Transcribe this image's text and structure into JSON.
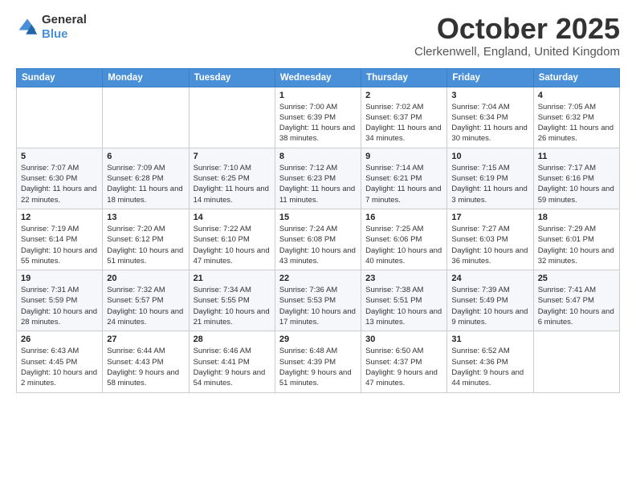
{
  "logo": {
    "general": "General",
    "blue": "Blue"
  },
  "header": {
    "month": "October 2025",
    "location": "Clerkenwell, England, United Kingdom"
  },
  "days_of_week": [
    "Sunday",
    "Monday",
    "Tuesday",
    "Wednesday",
    "Thursday",
    "Friday",
    "Saturday"
  ],
  "weeks": [
    [
      {
        "day": "",
        "info": ""
      },
      {
        "day": "",
        "info": ""
      },
      {
        "day": "",
        "info": ""
      },
      {
        "day": "1",
        "info": "Sunrise: 7:00 AM\nSunset: 6:39 PM\nDaylight: 11 hours and 38 minutes."
      },
      {
        "day": "2",
        "info": "Sunrise: 7:02 AM\nSunset: 6:37 PM\nDaylight: 11 hours and 34 minutes."
      },
      {
        "day": "3",
        "info": "Sunrise: 7:04 AM\nSunset: 6:34 PM\nDaylight: 11 hours and 30 minutes."
      },
      {
        "day": "4",
        "info": "Sunrise: 7:05 AM\nSunset: 6:32 PM\nDaylight: 11 hours and 26 minutes."
      }
    ],
    [
      {
        "day": "5",
        "info": "Sunrise: 7:07 AM\nSunset: 6:30 PM\nDaylight: 11 hours and 22 minutes."
      },
      {
        "day": "6",
        "info": "Sunrise: 7:09 AM\nSunset: 6:28 PM\nDaylight: 11 hours and 18 minutes."
      },
      {
        "day": "7",
        "info": "Sunrise: 7:10 AM\nSunset: 6:25 PM\nDaylight: 11 hours and 14 minutes."
      },
      {
        "day": "8",
        "info": "Sunrise: 7:12 AM\nSunset: 6:23 PM\nDaylight: 11 hours and 11 minutes."
      },
      {
        "day": "9",
        "info": "Sunrise: 7:14 AM\nSunset: 6:21 PM\nDaylight: 11 hours and 7 minutes."
      },
      {
        "day": "10",
        "info": "Sunrise: 7:15 AM\nSunset: 6:19 PM\nDaylight: 11 hours and 3 minutes."
      },
      {
        "day": "11",
        "info": "Sunrise: 7:17 AM\nSunset: 6:16 PM\nDaylight: 10 hours and 59 minutes."
      }
    ],
    [
      {
        "day": "12",
        "info": "Sunrise: 7:19 AM\nSunset: 6:14 PM\nDaylight: 10 hours and 55 minutes."
      },
      {
        "day": "13",
        "info": "Sunrise: 7:20 AM\nSunset: 6:12 PM\nDaylight: 10 hours and 51 minutes."
      },
      {
        "day": "14",
        "info": "Sunrise: 7:22 AM\nSunset: 6:10 PM\nDaylight: 10 hours and 47 minutes."
      },
      {
        "day": "15",
        "info": "Sunrise: 7:24 AM\nSunset: 6:08 PM\nDaylight: 10 hours and 43 minutes."
      },
      {
        "day": "16",
        "info": "Sunrise: 7:25 AM\nSunset: 6:06 PM\nDaylight: 10 hours and 40 minutes."
      },
      {
        "day": "17",
        "info": "Sunrise: 7:27 AM\nSunset: 6:03 PM\nDaylight: 10 hours and 36 minutes."
      },
      {
        "day": "18",
        "info": "Sunrise: 7:29 AM\nSunset: 6:01 PM\nDaylight: 10 hours and 32 minutes."
      }
    ],
    [
      {
        "day": "19",
        "info": "Sunrise: 7:31 AM\nSunset: 5:59 PM\nDaylight: 10 hours and 28 minutes."
      },
      {
        "day": "20",
        "info": "Sunrise: 7:32 AM\nSunset: 5:57 PM\nDaylight: 10 hours and 24 minutes."
      },
      {
        "day": "21",
        "info": "Sunrise: 7:34 AM\nSunset: 5:55 PM\nDaylight: 10 hours and 21 minutes."
      },
      {
        "day": "22",
        "info": "Sunrise: 7:36 AM\nSunset: 5:53 PM\nDaylight: 10 hours and 17 minutes."
      },
      {
        "day": "23",
        "info": "Sunrise: 7:38 AM\nSunset: 5:51 PM\nDaylight: 10 hours and 13 minutes."
      },
      {
        "day": "24",
        "info": "Sunrise: 7:39 AM\nSunset: 5:49 PM\nDaylight: 10 hours and 9 minutes."
      },
      {
        "day": "25",
        "info": "Sunrise: 7:41 AM\nSunset: 5:47 PM\nDaylight: 10 hours and 6 minutes."
      }
    ],
    [
      {
        "day": "26",
        "info": "Sunrise: 6:43 AM\nSunset: 4:45 PM\nDaylight: 10 hours and 2 minutes."
      },
      {
        "day": "27",
        "info": "Sunrise: 6:44 AM\nSunset: 4:43 PM\nDaylight: 9 hours and 58 minutes."
      },
      {
        "day": "28",
        "info": "Sunrise: 6:46 AM\nSunset: 4:41 PM\nDaylight: 9 hours and 54 minutes."
      },
      {
        "day": "29",
        "info": "Sunrise: 6:48 AM\nSunset: 4:39 PM\nDaylight: 9 hours and 51 minutes."
      },
      {
        "day": "30",
        "info": "Sunrise: 6:50 AM\nSunset: 4:37 PM\nDaylight: 9 hours and 47 minutes."
      },
      {
        "day": "31",
        "info": "Sunrise: 6:52 AM\nSunset: 4:36 PM\nDaylight: 9 hours and 44 minutes."
      },
      {
        "day": "",
        "info": ""
      }
    ]
  ]
}
